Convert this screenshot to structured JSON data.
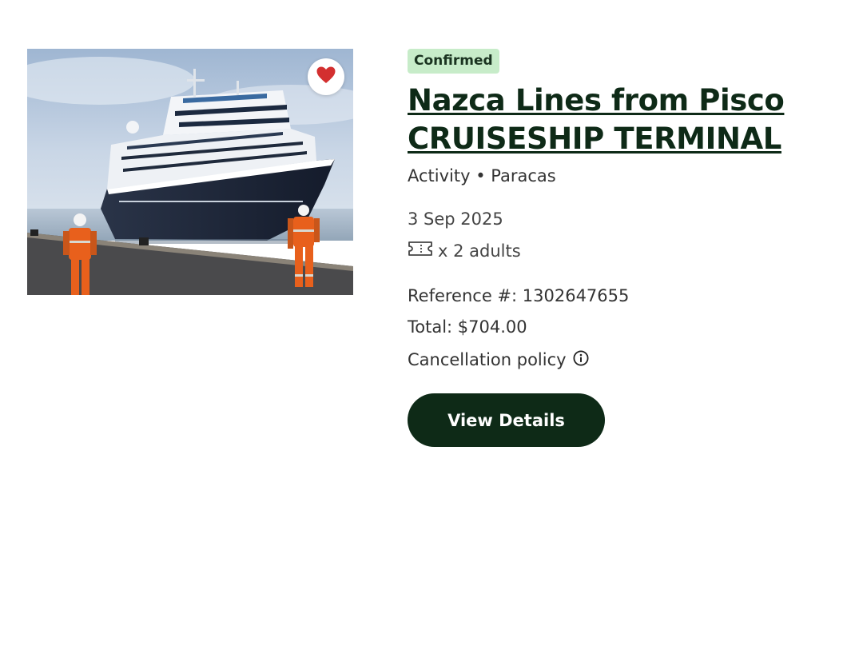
{
  "booking": {
    "status": "Confirmed",
    "title": "Nazca Lines from Pisco CRUISESHIP TERMINAL",
    "subtitle": "Activity • Paracas",
    "date": "3 Sep 2025",
    "tickets": "x 2 adults",
    "reference": "Reference #: 1302647655",
    "total": "Total: $704.00",
    "cancellation_label": "Cancellation policy",
    "view_details_label": "View Details",
    "favorited": true
  },
  "icons": {
    "favorite": "heart-icon",
    "tickets": "ticket-icon",
    "cancellation_info": "info-icon"
  },
  "colors": {
    "badge_bg": "#c7ecc9",
    "title": "#0e2a17",
    "button_bg": "#0e2a17",
    "heart": "#d32f2f"
  }
}
